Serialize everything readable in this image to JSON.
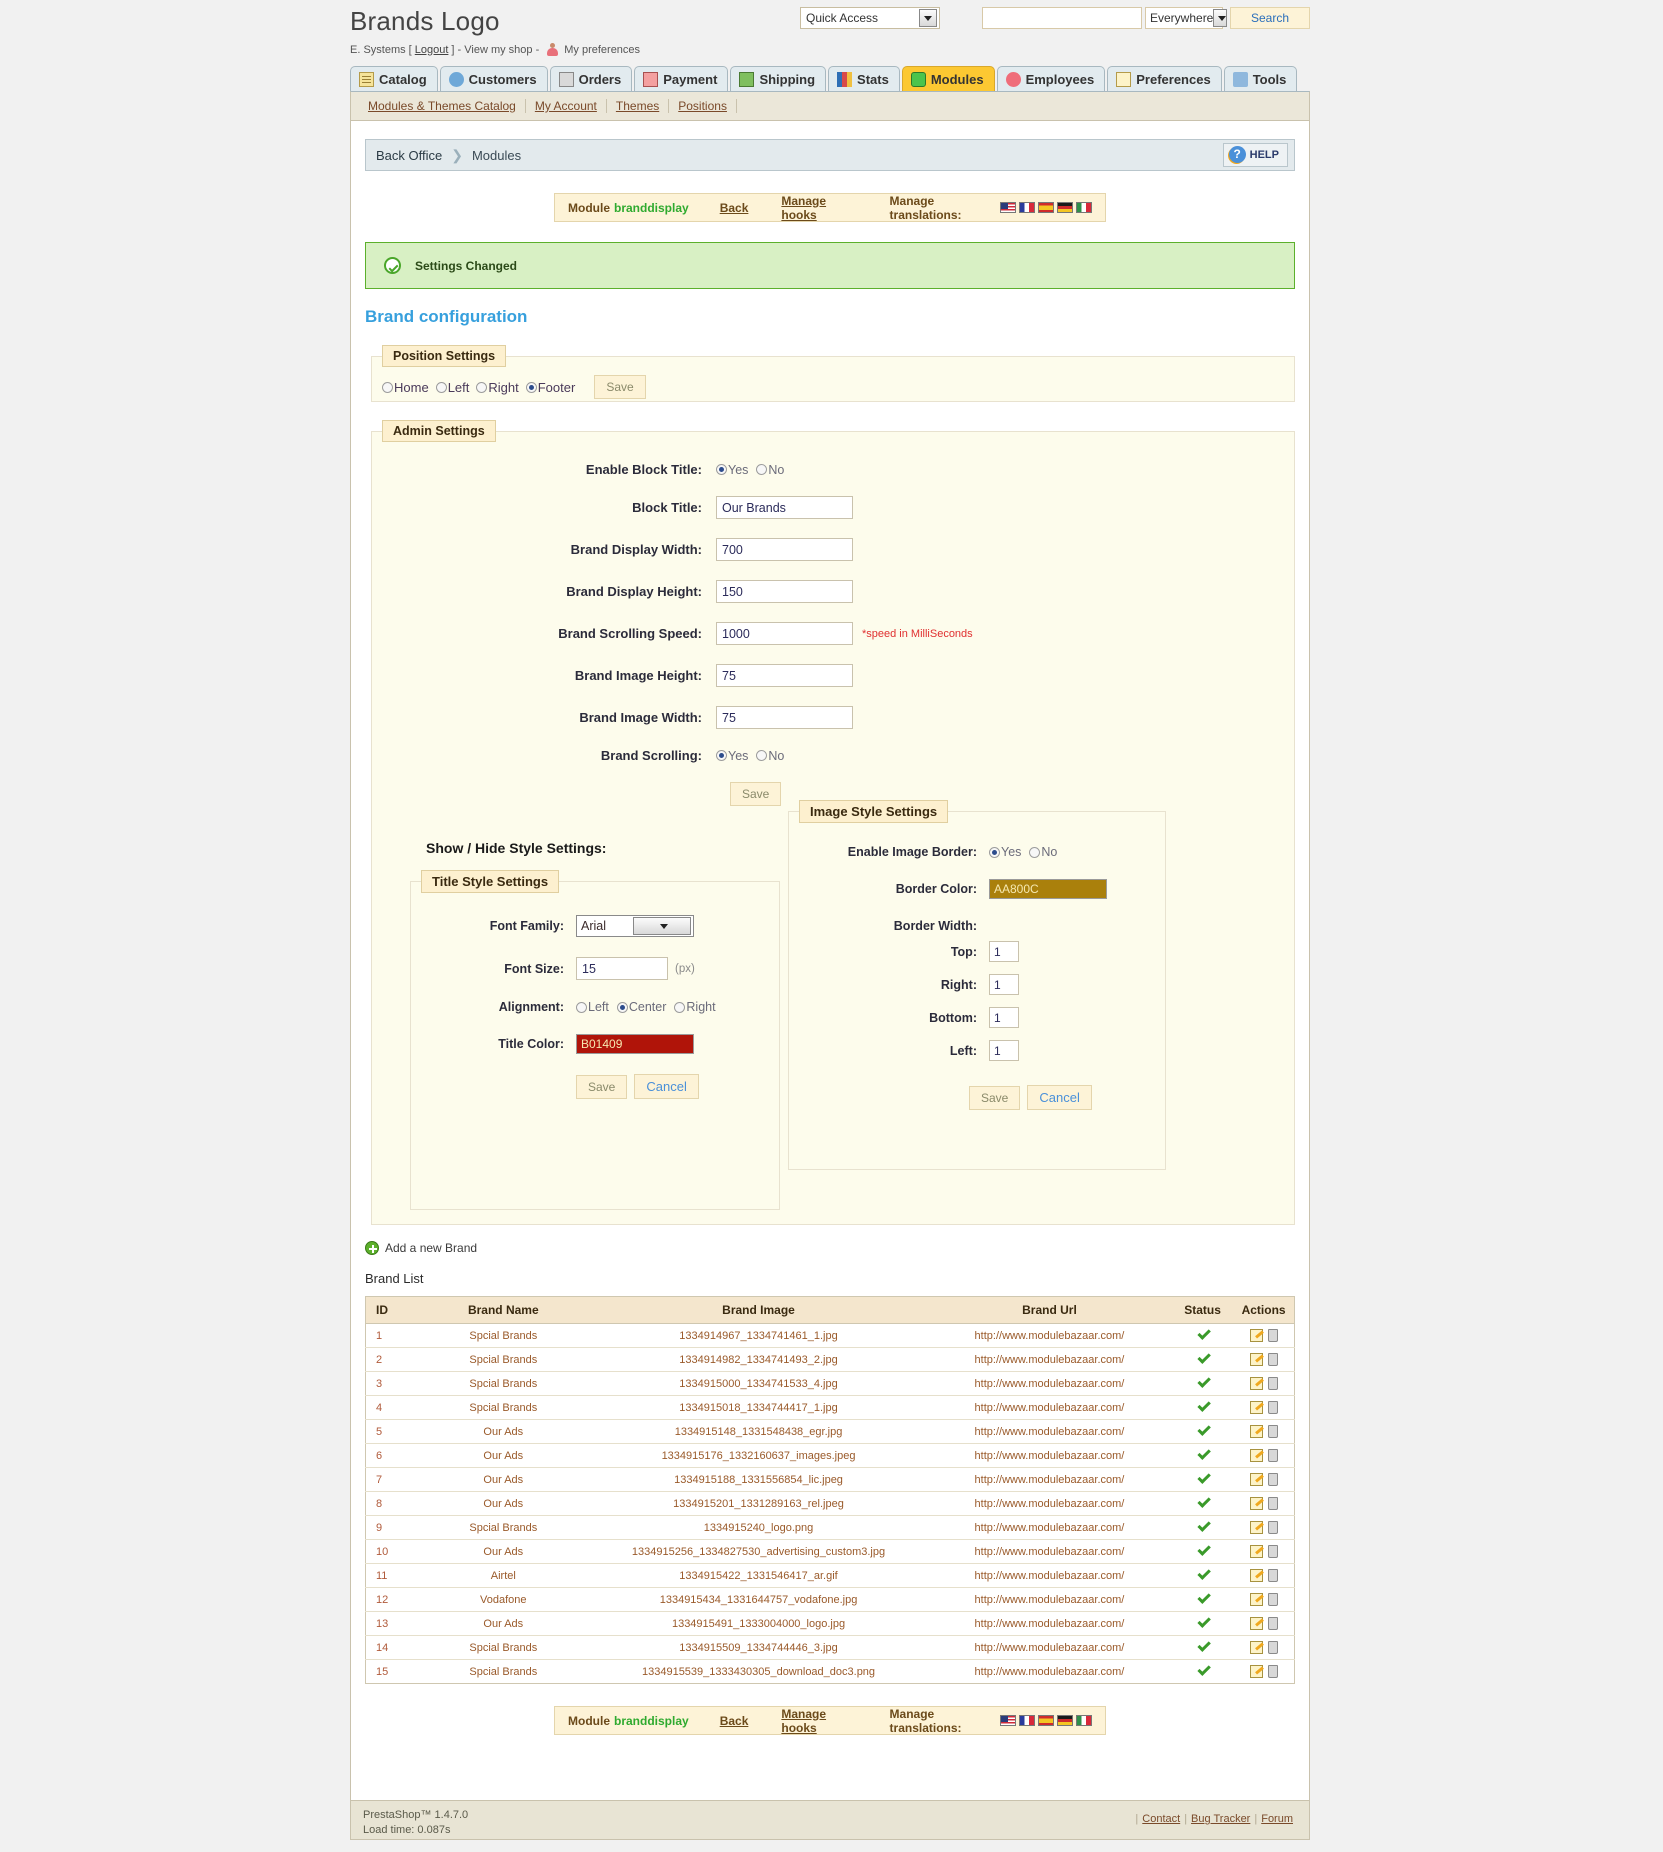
{
  "header": {
    "shop_title": "Brands Logo",
    "employee": "E. Systems [",
    "logout": "Logout",
    "sub_mid": "] - View my shop -",
    "my_preferences": "My preferences",
    "quick_access_label": "Quick Access",
    "search_value": "",
    "search_placeholder": "",
    "search_scope": "Everywhere",
    "search_button": "Search"
  },
  "tabs": [
    {
      "label": "Catalog",
      "icon": "catalog-icon",
      "active": false
    },
    {
      "label": "Customers",
      "icon": "customers-icon",
      "active": false
    },
    {
      "label": "Orders",
      "icon": "orders-icon",
      "active": false
    },
    {
      "label": "Payment",
      "icon": "payment-icon",
      "active": false
    },
    {
      "label": "Shipping",
      "icon": "shipping-icon",
      "active": false
    },
    {
      "label": "Stats",
      "icon": "stats-icon",
      "active": false
    },
    {
      "label": "Modules",
      "icon": "modules-icon",
      "active": true
    },
    {
      "label": "Employees",
      "icon": "employees-icon",
      "active": false
    },
    {
      "label": "Preferences",
      "icon": "preferences-icon",
      "active": false
    },
    {
      "label": "Tools",
      "icon": "tools-icon",
      "active": false
    }
  ],
  "subnav": [
    "Modules & Themes Catalog",
    "My Account",
    "Themes",
    "Positions"
  ],
  "breadcrumb": {
    "root": "Back Office",
    "current": "Modules",
    "help_label": "HELP"
  },
  "module_toolbar": {
    "module_word": "Module",
    "module_name": "branddisplay",
    "back": "Back",
    "manage_hooks": "Manage hooks",
    "manage_translations": "Manage translations:",
    "flags": [
      "flag-us-icon",
      "flag-fr-icon",
      "flag-es-icon",
      "flag-de-icon",
      "flag-it-icon"
    ]
  },
  "notice": {
    "text": "Settings Changed",
    "icon": "check-circle-icon",
    "bg": "#d8f0c4",
    "border": "#5cb02c"
  },
  "config_title": "Brand configuration",
  "position_settings": {
    "legend": "Position Settings",
    "options": [
      "Home",
      "Left",
      "Right",
      "Footer"
    ],
    "selected": "Footer",
    "save_label": "Save"
  },
  "admin_settings": {
    "legend": "Admin Settings",
    "enable_block_title": {
      "label": "Enable Block Title:",
      "yes": "Yes",
      "no": "No",
      "selected": "Yes"
    },
    "block_title": {
      "label": "Block Title:",
      "value": "Our Brands"
    },
    "display_width": {
      "label": "Brand Display Width:",
      "value": "700"
    },
    "display_height": {
      "label": "Brand Display Height:",
      "value": "150"
    },
    "scrolling_speed": {
      "label": "Brand Scrolling Speed:",
      "value": "1000",
      "hint": "*speed in MilliSeconds"
    },
    "image_height": {
      "label": "Brand Image Height:",
      "value": "75"
    },
    "image_width": {
      "label": "Brand Image Width:",
      "value": "75"
    },
    "brand_scrolling": {
      "label": "Brand Scrolling:",
      "yes": "Yes",
      "no": "No",
      "selected": "Yes"
    },
    "save_label": "Save"
  },
  "show_hide_label": "Show / Hide Style Settings:",
  "title_style": {
    "legend": "Title Style Settings",
    "font_family": {
      "label": "Font Family:",
      "value": "Arial"
    },
    "font_size": {
      "label": "Font Size:",
      "value": "15",
      "unit": "(px)"
    },
    "alignment": {
      "label": "Alignment:",
      "options": [
        "Left",
        "Center",
        "Right"
      ],
      "selected": "Center"
    },
    "title_color": {
      "label": "Title Color:",
      "value": "B01409",
      "swatch": "#B01409"
    },
    "save_label": "Save",
    "cancel_label": "Cancel"
  },
  "image_style": {
    "legend": "Image Style Settings",
    "enable_border": {
      "label": "Enable Image Border:",
      "yes": "Yes",
      "no": "No",
      "selected": "Yes"
    },
    "border_color": {
      "label": "Border Color:",
      "value": "AA800C",
      "swatch": "#AA800C"
    },
    "border_width_label": "Border Width:",
    "widths": [
      {
        "label": "Top:",
        "value": "1"
      },
      {
        "label": "Right:",
        "value": "1"
      },
      {
        "label": "Bottom:",
        "value": "1"
      },
      {
        "label": "Left:",
        "value": "1"
      }
    ],
    "save_label": "Save",
    "cancel_label": "Cancel"
  },
  "add_brand_label": "Add a new Brand",
  "brand_list": {
    "title": "Brand List",
    "columns": [
      "ID",
      "Brand Name",
      "Brand Image",
      "Brand Url",
      "Status",
      "Actions"
    ],
    "rows": [
      {
        "id": "1",
        "name": "Spcial Brands",
        "image": "1334914967_1334741461_1.jpg",
        "url": "http://www.modulebazaar.com/",
        "status": "active"
      },
      {
        "id": "2",
        "name": "Spcial Brands",
        "image": "1334914982_1334741493_2.jpg",
        "url": "http://www.modulebazaar.com/",
        "status": "active"
      },
      {
        "id": "3",
        "name": "Spcial Brands",
        "image": "1334915000_1334741533_4.jpg",
        "url": "http://www.modulebazaar.com/",
        "status": "active"
      },
      {
        "id": "4",
        "name": "Spcial Brands",
        "image": "1334915018_1334744417_1.jpg",
        "url": "http://www.modulebazaar.com/",
        "status": "active"
      },
      {
        "id": "5",
        "name": "Our Ads",
        "image": "1334915148_1331548438_egr.jpg",
        "url": "http://www.modulebazaar.com/",
        "status": "active"
      },
      {
        "id": "6",
        "name": "Our Ads",
        "image": "1334915176_1332160637_images.jpeg",
        "url": "http://www.modulebazaar.com/",
        "status": "active"
      },
      {
        "id": "7",
        "name": "Our Ads",
        "image": "1334915188_1331556854_lic.jpeg",
        "url": "http://www.modulebazaar.com/",
        "status": "active"
      },
      {
        "id": "8",
        "name": "Our Ads",
        "image": "1334915201_1331289163_rel.jpeg",
        "url": "http://www.modulebazaar.com/",
        "status": "active"
      },
      {
        "id": "9",
        "name": "Spcial Brands",
        "image": "1334915240_logo.png",
        "url": "http://www.modulebazaar.com/",
        "status": "active"
      },
      {
        "id": "10",
        "name": "Our Ads",
        "image": "1334915256_1334827530_advertising_custom3.jpg",
        "url": "http://www.modulebazaar.com/",
        "status": "active"
      },
      {
        "id": "11",
        "name": "Airtel",
        "image": "1334915422_1331546417_ar.gif",
        "url": "http://www.modulebazaar.com/",
        "status": "active"
      },
      {
        "id": "12",
        "name": "Vodafone",
        "image": "1334915434_1331644757_vodafone.jpg",
        "url": "http://www.modulebazaar.com/",
        "status": "active"
      },
      {
        "id": "13",
        "name": "Our Ads",
        "image": "1334915491_1333004000_logo.jpg",
        "url": "http://www.modulebazaar.com/",
        "status": "active"
      },
      {
        "id": "14",
        "name": "Spcial Brands",
        "image": "1334915509_1334744446_3.jpg",
        "url": "http://www.modulebazaar.com/",
        "status": "active"
      },
      {
        "id": "15",
        "name": "Spcial Brands",
        "image": "1334915539_1333430305_download_doc3.png",
        "url": "http://www.modulebazaar.com/",
        "status": "active"
      }
    ]
  },
  "footer": {
    "version": "PrestaShop™ 1.4.7.0",
    "load_time": "Load time: 0.087s",
    "links": [
      "Contact",
      "Bug Tracker",
      "Forum"
    ]
  }
}
